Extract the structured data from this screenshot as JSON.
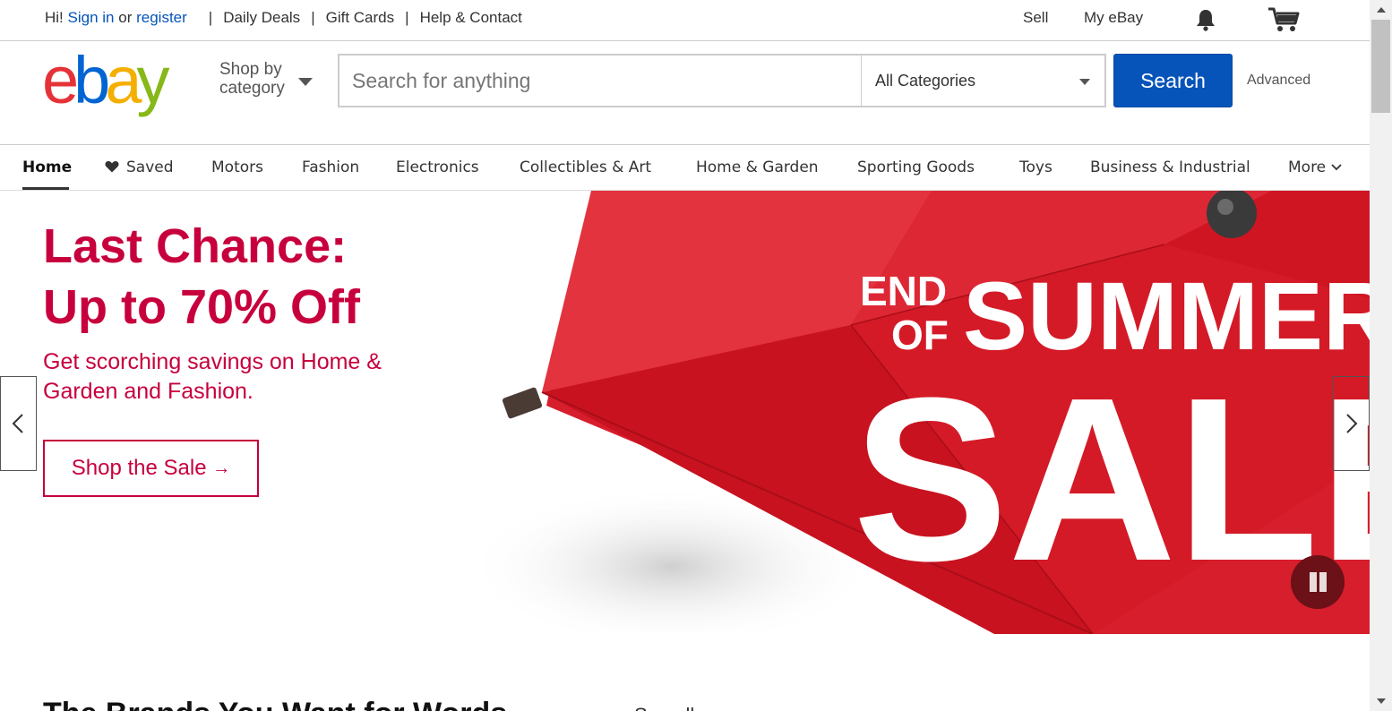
{
  "topbar": {
    "greeting": "Hi!",
    "sign_in": "Sign in",
    "or": "or",
    "register": "register",
    "links": [
      "Daily Deals",
      "Gift Cards",
      "Help & Contact"
    ],
    "sell": "Sell",
    "my_ebay": "My eBay"
  },
  "header": {
    "logo_letters": [
      "e",
      "b",
      "a",
      "y"
    ],
    "logo_colors": [
      "#e53238",
      "#0064d2",
      "#f5af02",
      "#86b817"
    ],
    "shop_by_line1": "Shop by",
    "shop_by_line2": "category",
    "search_placeholder": "Search for anything",
    "category_selected": "All Categories",
    "search_button": "Search",
    "advanced": "Advanced"
  },
  "nav": {
    "items": [
      "Home",
      "Saved",
      "Motors",
      "Fashion",
      "Electronics",
      "Collectibles & Art",
      "Home & Garden",
      "Sporting Goods",
      "Toys",
      "Business & Industrial",
      "More"
    ]
  },
  "hero": {
    "headline_line1": "Last Chance:",
    "headline_line2": "Up to 70% Off",
    "subtext": "Get scorching savings on Home & Garden and Fashion.",
    "cta": "Shop the Sale",
    "cta_arrow": "→",
    "banner_line1a": "END",
    "banner_line1b": "OF",
    "banner_line2": "SUMMER",
    "banner_line3": "SALE",
    "accent_color": "#c7003d"
  },
  "below": {
    "title": "The Brands You Want for Words",
    "sub": "See all"
  }
}
